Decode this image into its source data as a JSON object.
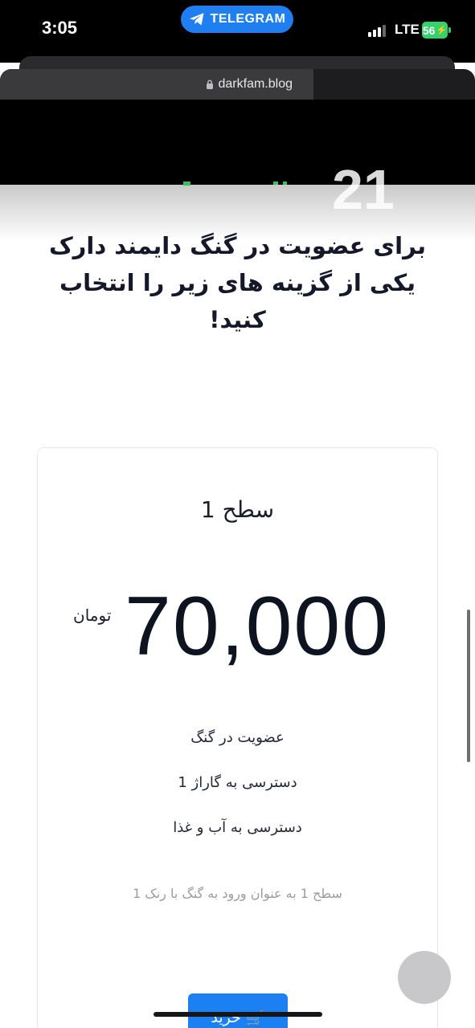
{
  "status_bar": {
    "time": "3:05",
    "back_app_label": "TELEGRAM",
    "network": "LTE",
    "battery": "56"
  },
  "browser": {
    "domain": "darkfam.blog"
  },
  "page": {
    "ghost_numeral": "21",
    "headline": "برای عضویت در گنگ دایمند دارک یکی از گزینه های زیر را انتخاب کنید!",
    "plan": {
      "name": "سطح 1",
      "price": "70,000",
      "currency": "تومان",
      "features": [
        "عضویت در گنگ",
        "دسترسی به گاراژ 1",
        "دسترسی به آب و غذا"
      ],
      "note": "سطح 1 به عنوان ورود به گنگ با رنک 1",
      "buy_label": "خرید"
    }
  },
  "colors": {
    "accent": "#1c7ff2",
    "telegram_pill": "#1f7ef0",
    "battery": "#36d16a",
    "page_text": "#0e1320"
  }
}
